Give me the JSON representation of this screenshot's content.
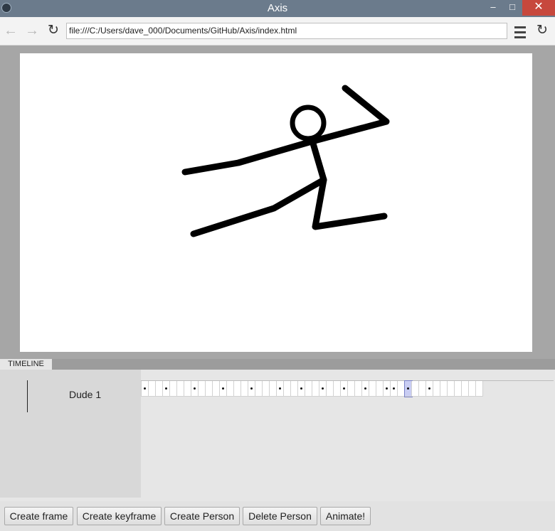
{
  "window": {
    "title": "Axis",
    "minimize_glyph": "–",
    "maximize_glyph": "□",
    "close_glyph": "✕"
  },
  "browser": {
    "url": "file:///C:/Users/dave_000/Documents/GitHub/Axis/index.html",
    "back_glyph": "←",
    "forward_glyph": "→",
    "reload_glyph": "↻"
  },
  "timeline": {
    "tab_label": "TIMELINE",
    "person": "Dude 1",
    "frame_count": 48,
    "keyframes": [
      0,
      3,
      7,
      11,
      15,
      19,
      22,
      25,
      28,
      31,
      34,
      35,
      37,
      40
    ],
    "selected_frame": 37
  },
  "buttons": {
    "create_frame": "Create frame",
    "create_keyframe": "Create keyframe",
    "create_person": "Create Person",
    "delete_person": "Delete Person",
    "animate": "Animate!"
  },
  "colors": {
    "titlebar": "#6b7b8c",
    "close": "#c7483d",
    "selected_frame": "#c9cdf3",
    "figure": "#000000"
  }
}
